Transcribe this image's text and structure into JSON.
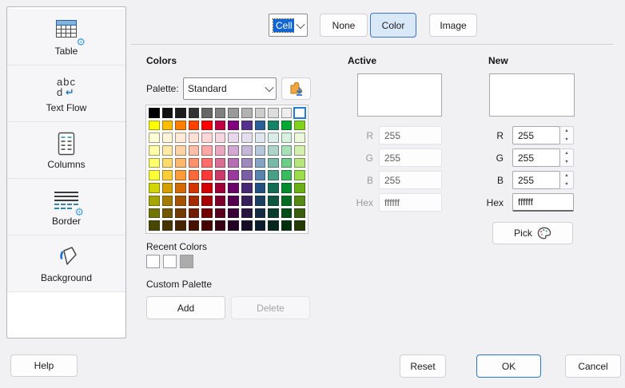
{
  "icons": {
    "gear": "⚙",
    "return_arrow": "↵",
    "textflow_abc": "abc",
    "textflow_d": "d",
    "spin_up": "▲",
    "spin_down": "▼"
  },
  "colors": {
    "dialog_bg": "#F1F0F3",
    "accent_selection_blue": "#1166D4",
    "active_fill_bg": "#D8E8F8",
    "active_fill_border": "#3A76C4",
    "ok_focus_border": "#2579CA",
    "grid_selected_outline": "#1E7BD7"
  },
  "sidebar": {
    "items": [
      {
        "label": "Table",
        "selected": false
      },
      {
        "label": "Text Flow",
        "selected": false
      },
      {
        "label": "Columns",
        "selected": false
      },
      {
        "label": "Border",
        "selected": false
      },
      {
        "label": "Background",
        "selected": true
      }
    ]
  },
  "header": {
    "area_select": {
      "value": "Cell"
    },
    "fill_options": [
      {
        "label": "None",
        "active": false
      },
      {
        "label": "Color",
        "active": true
      },
      {
        "label": "Image",
        "active": false
      }
    ]
  },
  "colors_section": {
    "title": "Colors",
    "palette_label": "Palette:",
    "palette_value": "Standard",
    "selected_index": 11,
    "palette_grid": [
      "#000000",
      "#111111",
      "#1C1C1C",
      "#333333",
      "#666666",
      "#808080",
      "#999999",
      "#B2B2B2",
      "#CCCCCC",
      "#DDDDDD",
      "#EEEEEE",
      "#FFFFFF",
      "#FFFF00",
      "#FFBF00",
      "#FF8000",
      "#FF4000",
      "#FF0000",
      "#BF0041",
      "#800080",
      "#55308D",
      "#2A6099",
      "#158466",
      "#00A933",
      "#81D41A",
      "#FFFFD7",
      "#FFF5D7",
      "#FFEBD7",
      "#FFE1D7",
      "#FFD7D7",
      "#F5D7E1",
      "#EBD7EB",
      "#E4DFED",
      "#DEE6EF",
      "#DAECE7",
      "#D7F1DF",
      "#EBF8DB",
      "#FFFFA6",
      "#FFE9A6",
      "#FFD3A6",
      "#FFBCA6",
      "#FFA6A6",
      "#E9A6BD",
      "#D3A6D3",
      "#C4B7D7",
      "#B5C8DB",
      "#ADD4CA",
      "#A6E1B8",
      "#D3F0AF",
      "#FFFF6D",
      "#FFDA6D",
      "#FFB66D",
      "#FF926D",
      "#FF6D6D",
      "#DA6D92",
      "#B66DB6",
      "#9E88BE",
      "#85A4C5",
      "#79B9A7",
      "#6DCE8A",
      "#B7E67C",
      "#FFFF38",
      "#FFCD38",
      "#FF9C38",
      "#FF6A38",
      "#FF3838",
      "#CD386B",
      "#9C389C",
      "#7A5EA6",
      "#5983AF",
      "#489F88",
      "#38BC60",
      "#9DDD4C",
      "#D4D400",
      "#D49F00",
      "#D46A00",
      "#D43500",
      "#D40000",
      "#9F0036",
      "#6A006A",
      "#472875",
      "#23507F",
      "#116E55",
      "#008C2A",
      "#6BB016",
      "#A6A600",
      "#A67C00",
      "#A65300",
      "#A62A00",
      "#A60000",
      "#7C002A",
      "#530053",
      "#371F5C",
      "#1B3E63",
      "#0E5642",
      "#006E21",
      "#548A11",
      "#737300",
      "#735600",
      "#733A00",
      "#731D00",
      "#730000",
      "#56001D",
      "#3A003A",
      "#26163F",
      "#132B45",
      "#093B2E",
      "#004C17",
      "#3A5F0C",
      "#474700",
      "#473500",
      "#472400",
      "#471200",
      "#470000",
      "#350012",
      "#240024",
      "#180D27",
      "#0C1B2B",
      "#06251D",
      "#002F0E",
      "#243B07"
    ],
    "recent_label": "Recent Colors",
    "recent_swatches": [
      "#FFFFFF",
      "#FFFFFF",
      "#ACACAC"
    ],
    "custom_label": "Custom Palette",
    "add_label": "Add",
    "delete_label": "Delete"
  },
  "active_section": {
    "title": "Active",
    "preview_color": "#FFFFFF",
    "r_label": "R",
    "g_label": "G",
    "b_label": "B",
    "hex_label": "Hex",
    "r": "255",
    "g": "255",
    "b": "255",
    "hex": "ffffff"
  },
  "new_section": {
    "title": "New",
    "preview_color": "#FFFFFF",
    "r_label": "R",
    "g_label": "G",
    "b_label": "B",
    "hex_label": "Hex",
    "r": "255",
    "g": "255",
    "b": "255",
    "hex": "ffffff",
    "pick_label": "Pick"
  },
  "footer": {
    "help_label": "Help",
    "reset_label": "Reset",
    "ok_label": "OK",
    "cancel_label": "Cancel"
  }
}
